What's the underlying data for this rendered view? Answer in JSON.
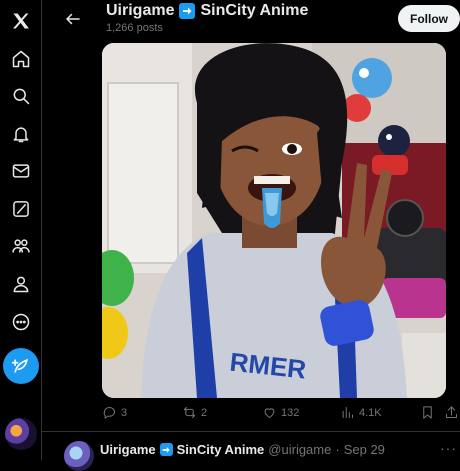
{
  "colors": {
    "accent": "#1d9bf0",
    "background": "#000000",
    "text": "#e7e9ea",
    "muted": "#71767b",
    "border": "#2f3336"
  },
  "sidebar": {
    "items": [
      {
        "name": "x-logo-icon"
      },
      {
        "name": "home-icon"
      },
      {
        "name": "search-icon"
      },
      {
        "name": "notifications-bell-icon"
      },
      {
        "name": "messages-envelope-icon"
      },
      {
        "name": "grok-icon"
      },
      {
        "name": "communities-icon"
      },
      {
        "name": "profile-icon"
      },
      {
        "name": "more-circle-icon"
      },
      {
        "name": "compose-post-icon"
      }
    ]
  },
  "header": {
    "title_part1": "Uirigame",
    "title_part2": "SinCity Anime",
    "posts_count": "1,266 posts",
    "follow_label": "Follow"
  },
  "post": {
    "actions": {
      "replies": "3",
      "reposts": "2",
      "likes": "132",
      "views": "4.1K"
    },
    "media_description_icon": "photo"
  },
  "next_post": {
    "name_part1": "Uirigame",
    "name_part2": "SinCity Anime",
    "handle": "@uirigame",
    "separator": "·",
    "date": "Sep 29",
    "more": "···"
  }
}
